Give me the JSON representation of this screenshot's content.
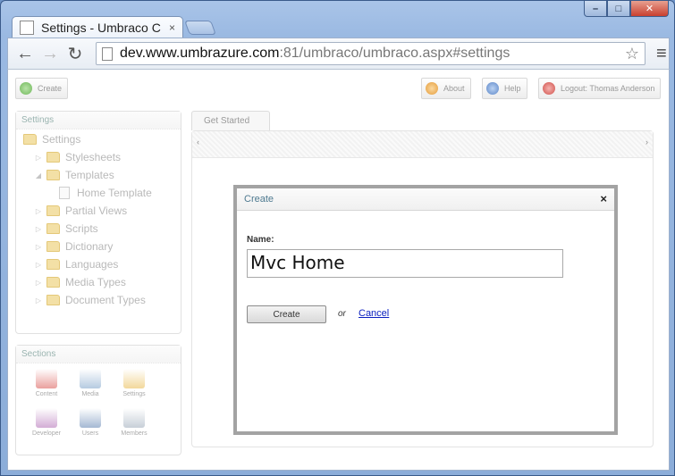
{
  "browser": {
    "tab_title": "Settings - Umbraco C",
    "tab_close": "×",
    "url_host": "dev.www.umbrazure.com",
    "url_rest": ":81/umbraco/umbraco.aspx#settings",
    "window_controls": {
      "minimize": "–",
      "maximize": "□",
      "close": "✕"
    },
    "nav": {
      "back": "←",
      "forward": "→",
      "reload": "↻",
      "star": "☆",
      "menu": "≡"
    }
  },
  "topbar": {
    "create_label": "Create",
    "about_label": "About",
    "help_label": "Help",
    "logout_label": "Logout: Thomas Anderson"
  },
  "tree_panel": {
    "title": "Settings",
    "items": [
      {
        "label": "Settings",
        "icon": "folder-icon",
        "level": 0,
        "arrow": ""
      },
      {
        "label": "Stylesheets",
        "icon": "folder-icon",
        "level": 1,
        "arrow": "▷"
      },
      {
        "label": "Templates",
        "icon": "folder-icon",
        "level": 1,
        "arrow": "◢"
      },
      {
        "label": "Home Template",
        "icon": "document-icon",
        "level": 2,
        "arrow": ""
      },
      {
        "label": "Partial Views",
        "icon": "folder-icon",
        "level": 1,
        "arrow": "▷"
      },
      {
        "label": "Scripts",
        "icon": "folder-icon",
        "level": 1,
        "arrow": "▷"
      },
      {
        "label": "Dictionary",
        "icon": "folder-icon",
        "level": 1,
        "arrow": "▷"
      },
      {
        "label": "Languages",
        "icon": "folder-icon",
        "level": 1,
        "arrow": "▷"
      },
      {
        "label": "Media Types",
        "icon": "folder-icon",
        "level": 1,
        "arrow": "▷"
      },
      {
        "label": "Document Types",
        "icon": "folder-icon",
        "level": 1,
        "arrow": "▷"
      }
    ]
  },
  "sections_panel": {
    "title": "Sections",
    "items": [
      {
        "label": "Content",
        "icon": "content-icon",
        "color": "#d9534f"
      },
      {
        "label": "Media",
        "icon": "media-icon",
        "color": "#7aa0c8"
      },
      {
        "label": "Settings",
        "icon": "settings-icon",
        "color": "#e8b84a"
      },
      {
        "label": "Developer",
        "icon": "developer-icon",
        "color": "#b06ab3"
      },
      {
        "label": "Users",
        "icon": "users-icon",
        "color": "#5b7fb0"
      },
      {
        "label": "Members",
        "icon": "members-icon",
        "color": "#9aa8b8"
      }
    ]
  },
  "main": {
    "tab_label": "Get Started",
    "scroll_left": "‹",
    "scroll_right": "›"
  },
  "dialog": {
    "title": "Create",
    "close": "×",
    "name_label": "Name:",
    "name_value": "Mvc Home",
    "create_button": "Create",
    "or_text": "or",
    "cancel_link": "Cancel"
  },
  "colors": {
    "accent_link": "#0a1fbf",
    "dialog_title": "#4f7a90",
    "folder": "#f3e0a6"
  }
}
